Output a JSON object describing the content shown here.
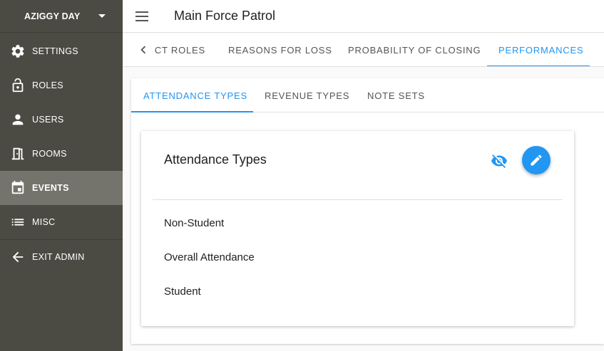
{
  "sidebar": {
    "org_name": "AZIGGY DAY",
    "items": [
      {
        "label": "SETTINGS",
        "icon": "gear-icon"
      },
      {
        "label": "ROLES",
        "icon": "lock-icon"
      },
      {
        "label": "USERS",
        "icon": "person-icon"
      },
      {
        "label": "ROOMS",
        "icon": "door-icon"
      },
      {
        "label": "EVENTS",
        "icon": "calendar-icon",
        "active": true
      },
      {
        "label": "MISC",
        "icon": "list-icon"
      },
      {
        "label": "EXIT ADMIN",
        "icon": "arrow-left-icon"
      }
    ]
  },
  "topbar": {
    "title": "Main Force Patrol"
  },
  "main_tabs": [
    {
      "label": "CT ROLES"
    },
    {
      "label": "REASONS FOR LOSS"
    },
    {
      "label": "PROBABILITY OF CLOSING"
    },
    {
      "label": "PERFORMANCES",
      "active": true
    }
  ],
  "sub_tabs": [
    {
      "label": "ATTENDANCE TYPES",
      "active": true
    },
    {
      "label": "REVENUE TYPES"
    },
    {
      "label": "NOTE SETS"
    }
  ],
  "card": {
    "title": "Attendance Types",
    "items": [
      "Non-Student",
      "Overall Attendance",
      "Student"
    ]
  },
  "colors": {
    "accent": "#2196f3",
    "sidebar_bg": "#4b4b43",
    "sidebar_active": "#74746c"
  }
}
